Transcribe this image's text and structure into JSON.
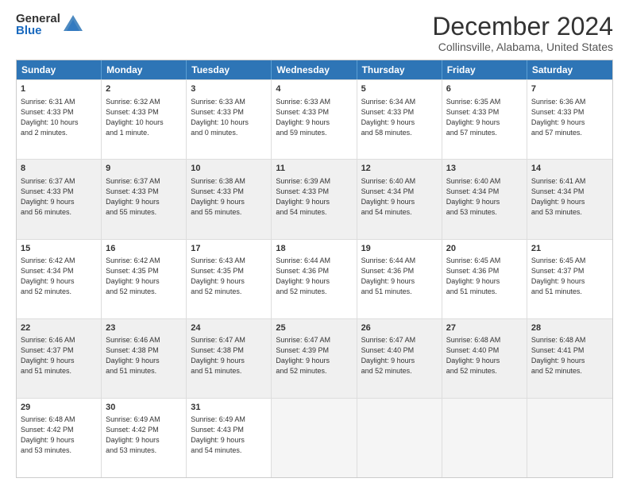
{
  "logo": {
    "general": "General",
    "blue": "Blue"
  },
  "title": "December 2024",
  "location": "Collinsville, Alabama, United States",
  "days_of_week": [
    "Sunday",
    "Monday",
    "Tuesday",
    "Wednesday",
    "Thursday",
    "Friday",
    "Saturday"
  ],
  "weeks": [
    [
      {
        "day": "1",
        "info": "Sunrise: 6:31 AM\nSunset: 4:33 PM\nDaylight: 10 hours\nand 2 minutes."
      },
      {
        "day": "2",
        "info": "Sunrise: 6:32 AM\nSunset: 4:33 PM\nDaylight: 10 hours\nand 1 minute."
      },
      {
        "day": "3",
        "info": "Sunrise: 6:33 AM\nSunset: 4:33 PM\nDaylight: 10 hours\nand 0 minutes."
      },
      {
        "day": "4",
        "info": "Sunrise: 6:33 AM\nSunset: 4:33 PM\nDaylight: 9 hours\nand 59 minutes."
      },
      {
        "day": "5",
        "info": "Sunrise: 6:34 AM\nSunset: 4:33 PM\nDaylight: 9 hours\nand 58 minutes."
      },
      {
        "day": "6",
        "info": "Sunrise: 6:35 AM\nSunset: 4:33 PM\nDaylight: 9 hours\nand 57 minutes."
      },
      {
        "day": "7",
        "info": "Sunrise: 6:36 AM\nSunset: 4:33 PM\nDaylight: 9 hours\nand 57 minutes."
      }
    ],
    [
      {
        "day": "8",
        "info": "Sunrise: 6:37 AM\nSunset: 4:33 PM\nDaylight: 9 hours\nand 56 minutes."
      },
      {
        "day": "9",
        "info": "Sunrise: 6:37 AM\nSunset: 4:33 PM\nDaylight: 9 hours\nand 55 minutes."
      },
      {
        "day": "10",
        "info": "Sunrise: 6:38 AM\nSunset: 4:33 PM\nDaylight: 9 hours\nand 55 minutes."
      },
      {
        "day": "11",
        "info": "Sunrise: 6:39 AM\nSunset: 4:33 PM\nDaylight: 9 hours\nand 54 minutes."
      },
      {
        "day": "12",
        "info": "Sunrise: 6:40 AM\nSunset: 4:34 PM\nDaylight: 9 hours\nand 54 minutes."
      },
      {
        "day": "13",
        "info": "Sunrise: 6:40 AM\nSunset: 4:34 PM\nDaylight: 9 hours\nand 53 minutes."
      },
      {
        "day": "14",
        "info": "Sunrise: 6:41 AM\nSunset: 4:34 PM\nDaylight: 9 hours\nand 53 minutes."
      }
    ],
    [
      {
        "day": "15",
        "info": "Sunrise: 6:42 AM\nSunset: 4:34 PM\nDaylight: 9 hours\nand 52 minutes."
      },
      {
        "day": "16",
        "info": "Sunrise: 6:42 AM\nSunset: 4:35 PM\nDaylight: 9 hours\nand 52 minutes."
      },
      {
        "day": "17",
        "info": "Sunrise: 6:43 AM\nSunset: 4:35 PM\nDaylight: 9 hours\nand 52 minutes."
      },
      {
        "day": "18",
        "info": "Sunrise: 6:44 AM\nSunset: 4:36 PM\nDaylight: 9 hours\nand 52 minutes."
      },
      {
        "day": "19",
        "info": "Sunrise: 6:44 AM\nSunset: 4:36 PM\nDaylight: 9 hours\nand 51 minutes."
      },
      {
        "day": "20",
        "info": "Sunrise: 6:45 AM\nSunset: 4:36 PM\nDaylight: 9 hours\nand 51 minutes."
      },
      {
        "day": "21",
        "info": "Sunrise: 6:45 AM\nSunset: 4:37 PM\nDaylight: 9 hours\nand 51 minutes."
      }
    ],
    [
      {
        "day": "22",
        "info": "Sunrise: 6:46 AM\nSunset: 4:37 PM\nDaylight: 9 hours\nand 51 minutes."
      },
      {
        "day": "23",
        "info": "Sunrise: 6:46 AM\nSunset: 4:38 PM\nDaylight: 9 hours\nand 51 minutes."
      },
      {
        "day": "24",
        "info": "Sunrise: 6:47 AM\nSunset: 4:38 PM\nDaylight: 9 hours\nand 51 minutes."
      },
      {
        "day": "25",
        "info": "Sunrise: 6:47 AM\nSunset: 4:39 PM\nDaylight: 9 hours\nand 52 minutes."
      },
      {
        "day": "26",
        "info": "Sunrise: 6:47 AM\nSunset: 4:40 PM\nDaylight: 9 hours\nand 52 minutes."
      },
      {
        "day": "27",
        "info": "Sunrise: 6:48 AM\nSunset: 4:40 PM\nDaylight: 9 hours\nand 52 minutes."
      },
      {
        "day": "28",
        "info": "Sunrise: 6:48 AM\nSunset: 4:41 PM\nDaylight: 9 hours\nand 52 minutes."
      }
    ],
    [
      {
        "day": "29",
        "info": "Sunrise: 6:48 AM\nSunset: 4:42 PM\nDaylight: 9 hours\nand 53 minutes."
      },
      {
        "day": "30",
        "info": "Sunrise: 6:49 AM\nSunset: 4:42 PM\nDaylight: 9 hours\nand 53 minutes."
      },
      {
        "day": "31",
        "info": "Sunrise: 6:49 AM\nSunset: 4:43 PM\nDaylight: 9 hours\nand 54 minutes."
      },
      {
        "day": "",
        "info": ""
      },
      {
        "day": "",
        "info": ""
      },
      {
        "day": "",
        "info": ""
      },
      {
        "day": "",
        "info": ""
      }
    ]
  ]
}
